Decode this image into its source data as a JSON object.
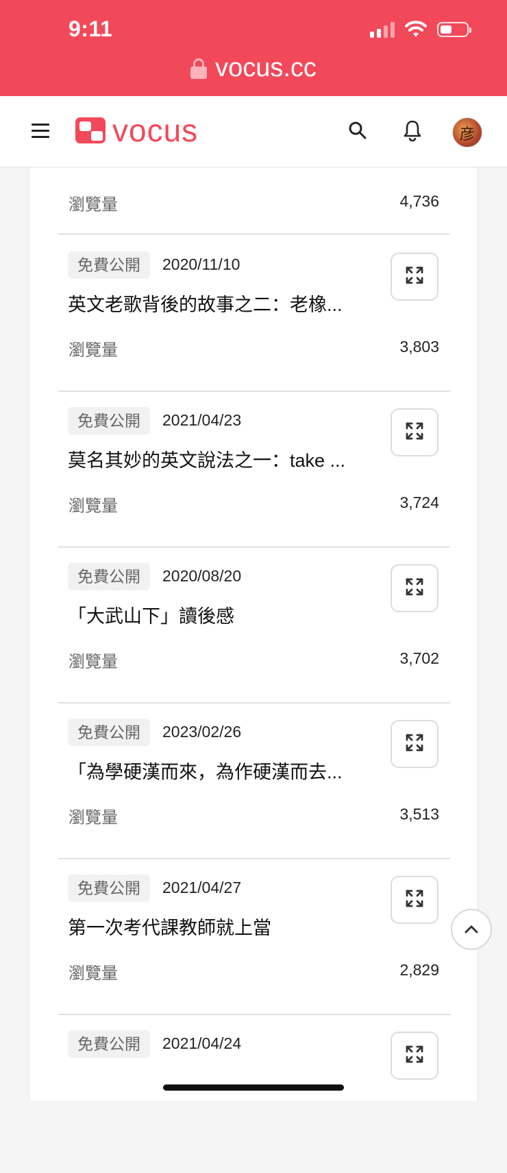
{
  "status_bar": {
    "time": "9:11",
    "battery_level": 0.45
  },
  "url_bar": {
    "domain": "vocus.cc"
  },
  "header": {
    "logo_text": "vocus",
    "avatar_glyph": "彦"
  },
  "list": {
    "first_row": {
      "stat_label": "瀏覽量",
      "stat_value": "4,736"
    },
    "items": [
      {
        "badge": "免費公開",
        "date": "2020/11/10",
        "title": "英文老歌背後的故事之二：老橡...",
        "stat_label": "瀏覽量",
        "stat_value": "3,803"
      },
      {
        "badge": "免費公開",
        "date": "2021/04/23",
        "title": "莫名其妙的英文說法之一：take ...",
        "stat_label": "瀏覽量",
        "stat_value": "3,724"
      },
      {
        "badge": "免費公開",
        "date": "2020/08/20",
        "title": "「大武山下」讀後感",
        "stat_label": "瀏覽量",
        "stat_value": "3,702"
      },
      {
        "badge": "免費公開",
        "date": "2023/02/26",
        "title": "「為學硬漢而來，為作硬漢而去...",
        "stat_label": "瀏覽量",
        "stat_value": "3,513"
      },
      {
        "badge": "免費公開",
        "date": "2021/04/27",
        "title": "第一次考代課教師就上當",
        "stat_label": "瀏覽量",
        "stat_value": "2,829"
      },
      {
        "badge": "免費公開",
        "date": "2021/04/24",
        "title": "",
        "stat_label": "",
        "stat_value": ""
      }
    ]
  },
  "colors": {
    "brand": "#f2495a",
    "divider": "#e0e0e0",
    "badge_bg": "#f1f1f1"
  },
  "icons": [
    "lock-icon",
    "menu-icon",
    "search-icon",
    "bell-icon",
    "expand-icon",
    "chevron-up-icon"
  ]
}
